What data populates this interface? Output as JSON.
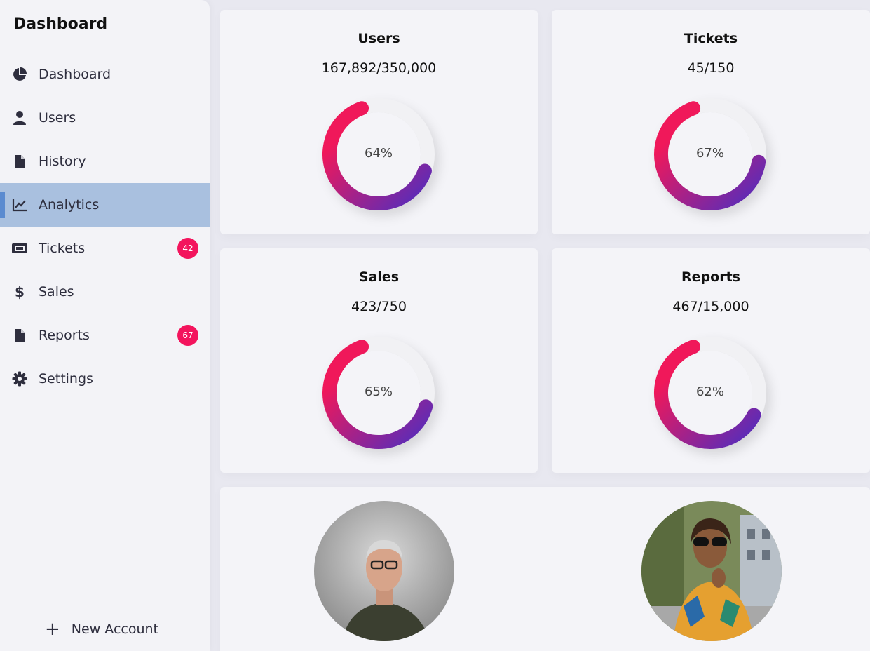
{
  "sidebar": {
    "brand": "Dashboard",
    "items": [
      {
        "label": "Dashboard",
        "icon": "pie-chart-icon"
      },
      {
        "label": "Users",
        "icon": "user-icon"
      },
      {
        "label": "History",
        "icon": "file-icon"
      },
      {
        "label": "Analytics",
        "icon": "line-chart-icon",
        "active": true
      },
      {
        "label": "Tickets",
        "icon": "ticket-icon",
        "badge": "42"
      },
      {
        "label": "Sales",
        "icon": "dollar-icon"
      },
      {
        "label": "Reports",
        "icon": "file-icon",
        "badge": "67"
      },
      {
        "label": "Settings",
        "icon": "gear-icon"
      }
    ],
    "new_account": "New Account"
  },
  "stats": [
    {
      "title": "Users",
      "count": "167,892/350,000",
      "percent": "64%",
      "fraction": 0.64
    },
    {
      "title": "Tickets",
      "count": "45/150",
      "percent": "67%",
      "fraction": 0.67
    },
    {
      "title": "Sales",
      "count": "423/750",
      "percent": "65%",
      "fraction": 0.65
    },
    {
      "title": "Reports",
      "count": "467/15,000",
      "percent": "62%",
      "fraction": 0.62
    }
  ],
  "colors": {
    "gradient_start": "#f0185a",
    "gradient_end": "#5a2cb8",
    "active_bg": "#a9c0df",
    "active_bar": "#5b8bd0",
    "badge": "#f3145d"
  }
}
